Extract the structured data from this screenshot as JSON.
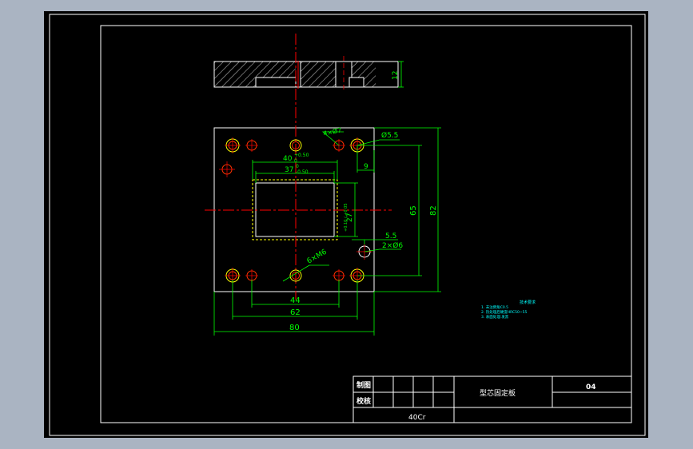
{
  "colors": {
    "background": "#aab4c2",
    "paper": "#000000",
    "frame": "#ffffff",
    "dimension": "#00ff00",
    "centerline": "#ff0000",
    "hole_outer": "#ffff00",
    "hole_inner": "#ff3300",
    "hatch": "#ffffff",
    "note": "#00ffff"
  },
  "dimensions": {
    "width_80": "80",
    "height_82": "82",
    "hole_span_62": "62",
    "hole_span_44": "44",
    "pocket_40": "40",
    "pocket_40_tol": "+0.50",
    "pocket_40_tol_low": "0",
    "pocket_37": "37",
    "pocket_37_tol": "0",
    "pocket_37_tol_low": "-0.50",
    "pocket_27": "27",
    "pocket_27_tol": "+0.10 / +0.05",
    "edge_9": "9",
    "edge_5_5": "5.5",
    "height_65": "65",
    "thickness_12": "12",
    "hole_dia_5_5": "Ø5.5",
    "hole_6x_m6": "6×M6",
    "hole_2x_dia6": "2×Ø6",
    "hole_4x_dia7": "4×Ø7"
  },
  "notes": {
    "title": "技术要求",
    "line1": "1. 未注倒角C0.5",
    "line2": "2. 热处理后硬度HRC50~55",
    "line3": "3. 表面处理:发黑"
  },
  "title_block": {
    "drawn_label": "制图",
    "checked_label": "校核",
    "part_name": "型芯固定板",
    "part_number": "04",
    "material": "40Cr"
  }
}
